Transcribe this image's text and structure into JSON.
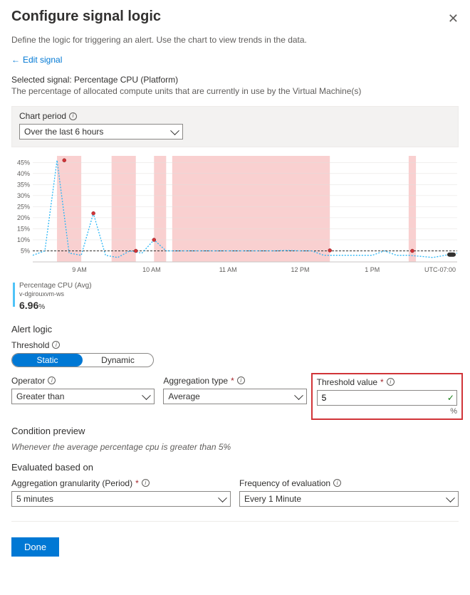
{
  "header": {
    "title": "Configure signal logic",
    "subtitle": "Define the logic for triggering an alert. Use the chart to view trends in the data.",
    "edit_link": "Edit signal"
  },
  "selected_signal": {
    "label": "Selected signal: Percentage CPU (Platform)",
    "description": "The percentage of allocated compute units that are currently in use by the Virtual Machine(s)"
  },
  "chart_period": {
    "label": "Chart period",
    "value": "Over the last 6 hours"
  },
  "chart_data": {
    "type": "line",
    "title": "",
    "xlabel": "",
    "ylabel": "",
    "ylim": [
      0,
      48
    ],
    "y_ticks": [
      "5%",
      "10%",
      "15%",
      "20%",
      "25%",
      "30%",
      "35%",
      "40%",
      "45%"
    ],
    "x_ticks": [
      "9 AM",
      "10 AM",
      "11 AM",
      "12 PM",
      "1 PM",
      "UTC-07:00"
    ],
    "threshold_line": 5,
    "series": [
      {
        "name": "Percentage CPU (Avg)",
        "color": "#29b6f6",
        "values": [
          3,
          5,
          46,
          4,
          3,
          22,
          3,
          2,
          5,
          4,
          10,
          5,
          5,
          5,
          5,
          5,
          5,
          5,
          5,
          5,
          5,
          5.2,
          5,
          5,
          3,
          3,
          3,
          3,
          3,
          5,
          3,
          3,
          2.5,
          2,
          3,
          4
        ]
      }
    ],
    "alert_bands": [
      [
        2,
        4
      ],
      [
        6.5,
        8.5
      ],
      [
        10,
        11
      ],
      [
        11.5,
        24.5
      ],
      [
        31,
        31.6
      ]
    ],
    "markers": [
      {
        "x": 2.6,
        "y": 46,
        "c": "#d13438"
      },
      {
        "x": 5,
        "y": 22,
        "c": "#d13438"
      },
      {
        "x": 8.5,
        "y": 5,
        "c": "#d13438"
      },
      {
        "x": 10,
        "y": 10,
        "c": "#d13438"
      },
      {
        "x": 24.5,
        "y": 5.2,
        "c": "#d13438"
      },
      {
        "x": 31.3,
        "y": 5,
        "c": "#d13438"
      }
    ]
  },
  "legend": {
    "metric": "Percentage CPU (Avg)",
    "resource": "v-dgirouxvm-ws",
    "value": "6.96",
    "unit": "%"
  },
  "alert_logic": {
    "section": "Alert logic",
    "threshold_label": "Threshold",
    "static": "Static",
    "dynamic": "Dynamic",
    "operator_label": "Operator",
    "operator_value": "Greater than",
    "agg_type_label": "Aggregation type",
    "agg_type_value": "Average",
    "threshold_value_label": "Threshold value",
    "threshold_value": "5",
    "threshold_unit": "%"
  },
  "condition_preview": {
    "label": "Condition preview",
    "text": "Whenever the average percentage cpu is greater than 5%"
  },
  "evaluated": {
    "label": "Evaluated based on",
    "granularity_label": "Aggregation granularity (Period)",
    "granularity_value": "5 minutes",
    "freq_label": "Frequency of evaluation",
    "freq_value": "Every 1 Minute"
  },
  "done": "Done"
}
